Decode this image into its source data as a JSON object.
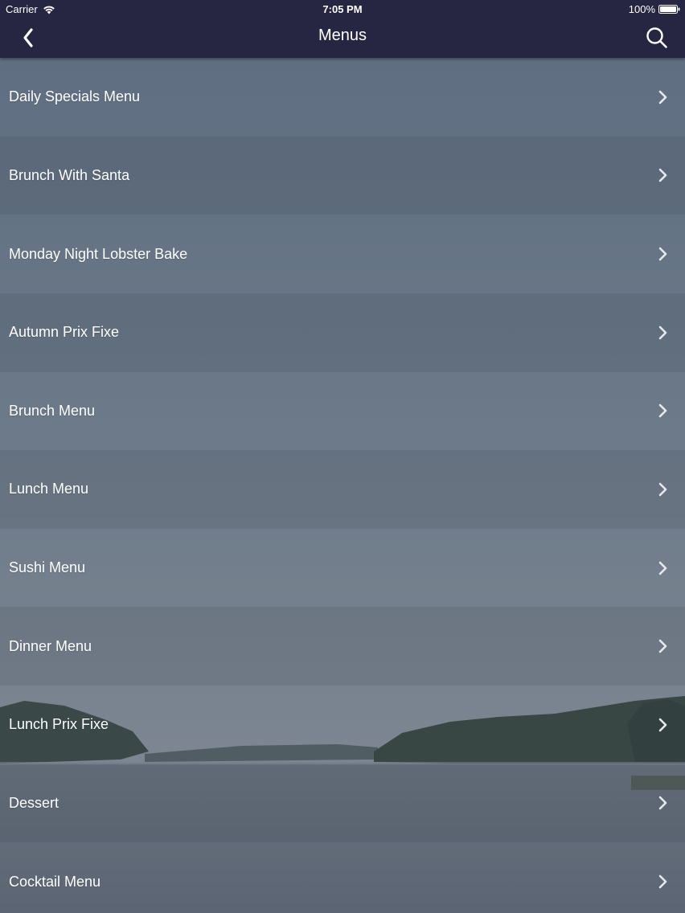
{
  "status_bar": {
    "carrier": "Carrier",
    "time": "7:05 PM",
    "battery": "100%"
  },
  "nav": {
    "title": "Menus",
    "back_icon": "chevron-left-icon",
    "search_icon": "search-icon"
  },
  "colors": {
    "nav_background": "#262643",
    "text": "#ffffff",
    "chevron": "#e6e9ee"
  },
  "menu_items": [
    {
      "label": "Daily Specials Menu"
    },
    {
      "label": "Brunch With Santa"
    },
    {
      "label": "Monday Night Lobster Bake"
    },
    {
      "label": "Autumn Prix Fixe"
    },
    {
      "label": "Brunch Menu"
    },
    {
      "label": "Lunch Menu"
    },
    {
      "label": "Sushi Menu"
    },
    {
      "label": "Dinner Menu"
    },
    {
      "label": "Lunch Prix Fixe"
    },
    {
      "label": "Dessert"
    },
    {
      "label": "Cocktail Menu"
    }
  ]
}
